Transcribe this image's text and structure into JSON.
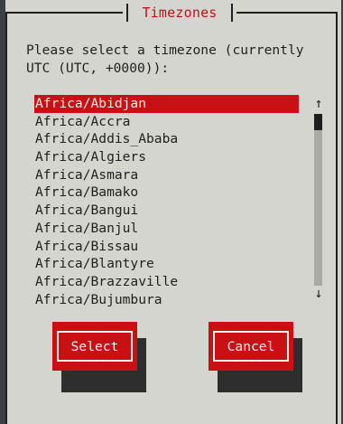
{
  "dialog": {
    "title": "Timezones",
    "prompt": "Please select a timezone (currently\nUTC (UTC, +0000)):"
  },
  "list": {
    "items": [
      {
        "label": "Africa/Abidjan",
        "selected": true
      },
      {
        "label": "Africa/Accra",
        "selected": false
      },
      {
        "label": "Africa/Addis_Ababa",
        "selected": false
      },
      {
        "label": "Africa/Algiers",
        "selected": false
      },
      {
        "label": "Africa/Asmara",
        "selected": false
      },
      {
        "label": "Africa/Bamako",
        "selected": false
      },
      {
        "label": "Africa/Bangui",
        "selected": false
      },
      {
        "label": "Africa/Banjul",
        "selected": false
      },
      {
        "label": "Africa/Bissau",
        "selected": false
      },
      {
        "label": "Africa/Blantyre",
        "selected": false
      },
      {
        "label": "Africa/Brazzaville",
        "selected": false
      },
      {
        "label": "Africa/Bujumbura",
        "selected": false
      }
    ]
  },
  "scrollbar": {
    "up_glyph": "↑",
    "down_glyph": "↓"
  },
  "buttons": {
    "select_label": "Select",
    "cancel_label": "Cancel"
  },
  "colors": {
    "accent": "#c81015",
    "background": "#d5d5d0",
    "text": "#202020"
  },
  "icons": {
    "scroll_up": "arrow-up-icon",
    "scroll_down": "arrow-down-icon"
  }
}
